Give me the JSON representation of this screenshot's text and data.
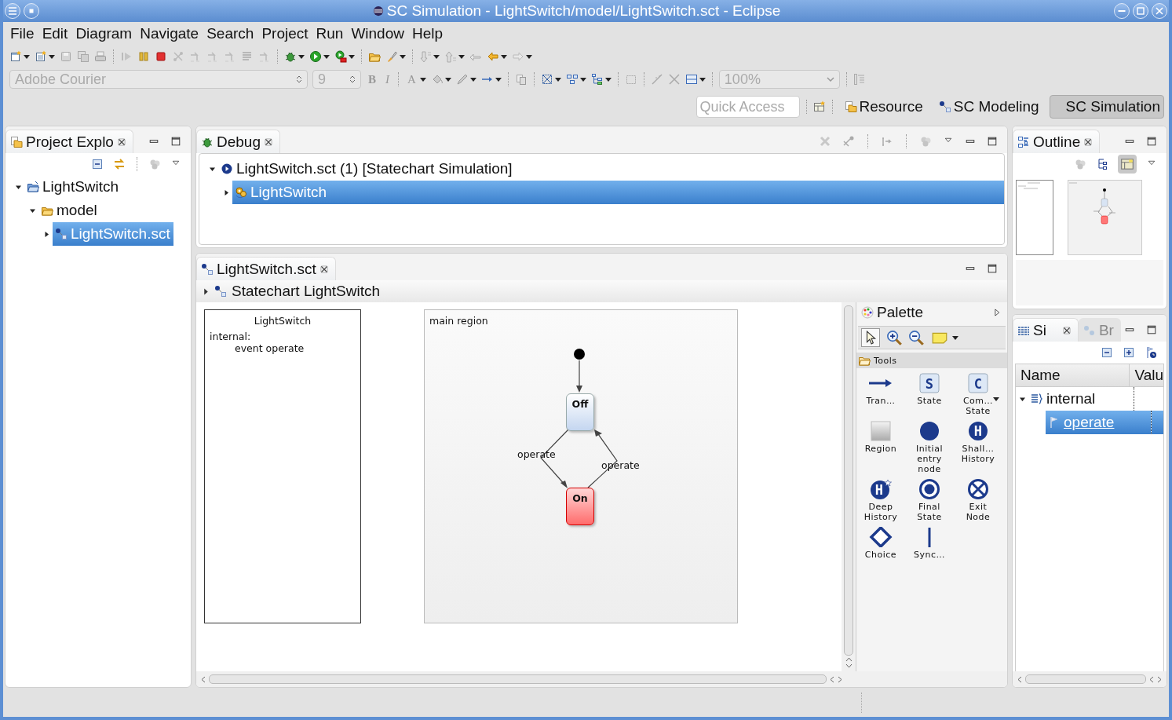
{
  "window": {
    "title": "SC Simulation - LightSwitch/model/LightSwitch.sct - Eclipse"
  },
  "menu": [
    "File",
    "Edit",
    "Diagram",
    "Navigate",
    "Search",
    "Project",
    "Run",
    "Window",
    "Help"
  ],
  "format_toolbar": {
    "font": {
      "value": "Adobe Courier",
      "disabled": true
    },
    "size": {
      "value": "9",
      "disabled": true
    },
    "bold": "B",
    "italic": "I",
    "font_color": "A",
    "zoom": {
      "value": "100%",
      "disabled": true
    }
  },
  "quick_access": {
    "placeholder": "Quick Access"
  },
  "perspectives": [
    {
      "label": "Resource",
      "kind": "resource",
      "selected": false
    },
    {
      "label": "SC Modeling",
      "kind": "modeling",
      "selected": false
    },
    {
      "label": "SC Simulation",
      "kind": "plain",
      "selected": true
    }
  ],
  "project_explorer": {
    "title": "Project Explo",
    "tree": [
      {
        "label": "LightSwitch",
        "kind": "project",
        "expanded": true,
        "selected": false,
        "children": [
          {
            "label": "model",
            "kind": "folder",
            "expanded": true,
            "selected": false,
            "children": [
              {
                "label": "LightSwitch.sct",
                "kind": "statechart",
                "expanded": false,
                "selected": true
              }
            ]
          }
        ]
      }
    ]
  },
  "debug": {
    "title": "Debug",
    "tree": [
      {
        "label": "LightSwitch.sct (1) [Statechart Simulation]",
        "kind": "launch",
        "expanded": true,
        "selected": false,
        "children": [
          {
            "label": "LightSwitch",
            "kind": "target",
            "expanded": false,
            "selected": true
          }
        ]
      }
    ]
  },
  "editor": {
    "tab": "LightSwitch.sct",
    "breadcrumb": "Statechart LightSwitch",
    "definition": {
      "title": "LightSwitch",
      "scope": "internal:",
      "declaration": "event operate"
    },
    "region": {
      "title": "main region",
      "states": [
        {
          "name": "Off",
          "active": false
        },
        {
          "name": "On",
          "active": true
        }
      ],
      "transitions": [
        "operate",
        "operate"
      ]
    }
  },
  "palette": {
    "title": "Palette",
    "drawer": "Tools",
    "tools": [
      {
        "label": "Tran…",
        "kind": "transition"
      },
      {
        "label": "State",
        "kind": "state",
        "glyph": "S"
      },
      {
        "label": "Com… State",
        "kind": "composite",
        "glyph": "C"
      },
      {
        "label": "Region",
        "kind": "region"
      },
      {
        "label": "Initial entry node",
        "kind": "initial"
      },
      {
        "label": "Shall… History",
        "kind": "shallow",
        "glyph": "H"
      },
      {
        "label": "Deep History",
        "kind": "deep",
        "glyph": "H"
      },
      {
        "label": "Final State",
        "kind": "final"
      },
      {
        "label": "Exit Node",
        "kind": "exit"
      },
      {
        "label": "Choice",
        "kind": "choice"
      },
      {
        "label": "Sync…",
        "kind": "sync"
      }
    ]
  },
  "outline": {
    "title": "Outline"
  },
  "simulation": {
    "tabs": [
      {
        "label": "Si",
        "kind": "table",
        "selected": true
      },
      {
        "label": "Br",
        "kind": "dots",
        "selected": false
      }
    ],
    "columns": [
      "Name",
      "Valu"
    ],
    "rows": [
      {
        "name": "internal",
        "kind": "scope",
        "expanded": true,
        "selected": false,
        "children": [
          {
            "name": "operate",
            "kind": "event",
            "selected": true
          }
        ]
      }
    ]
  }
}
